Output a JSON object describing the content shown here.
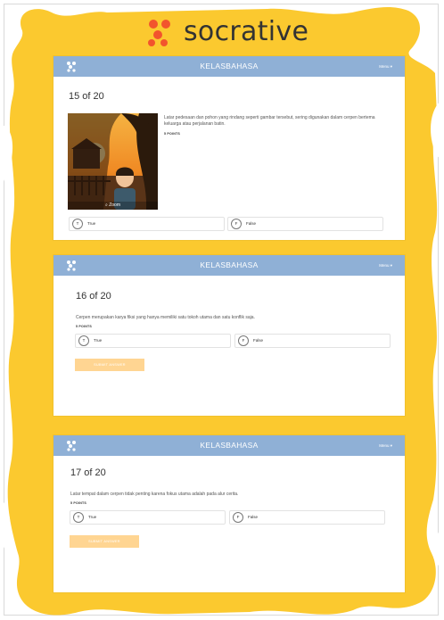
{
  "brand": {
    "name": "socrative",
    "logo_color": "#f2542d"
  },
  "colors": {
    "background": "#fbc92f",
    "header": "#8fb0d6",
    "submit": "#ffd592"
  },
  "cards": [
    {
      "header_title": "KELASBAHASA",
      "menu_label": "Menu",
      "question_number": "15 of 20",
      "question_text": "Latar pedesaan dan pohon yang rindang seperti gambar tersebut, sering digunakan dalam cerpen bertema keluarga atau perjalanan batin.",
      "points": "5 POINTS",
      "image_zoom_label": "Zoom",
      "answers": [
        {
          "key": "T",
          "label": "True"
        },
        {
          "key": "F",
          "label": "False"
        }
      ]
    },
    {
      "header_title": "KELASBAHASA",
      "menu_label": "Menu",
      "question_number": "16 of 20",
      "question_text": "Cerpen merupakan karya fiksi yang hanya memiliki satu tokoh utama dan satu konflik saja.",
      "points": "5 POINTS",
      "answers": [
        {
          "key": "T",
          "label": "True"
        },
        {
          "key": "F",
          "label": "False"
        }
      ],
      "submit_label": "SUBMIT ANSWER"
    },
    {
      "header_title": "KELASBAHASA",
      "menu_label": "Menu",
      "question_number": "17 of 20",
      "question_text": "Latar tempat dalam cerpen tidak penting karena fokus utama adalah pada alur cerita.",
      "points": "5 POINTS",
      "answers": [
        {
          "key": "T",
          "label": "True"
        },
        {
          "key": "F",
          "label": "False"
        }
      ],
      "submit_label": "SUBMIT ANSWER"
    }
  ]
}
